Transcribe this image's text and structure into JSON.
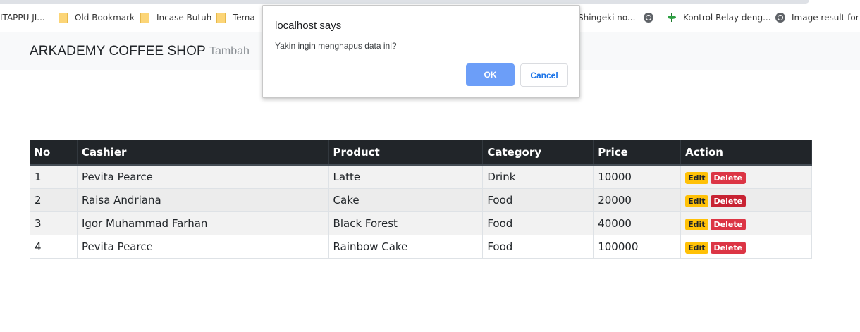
{
  "bookmarks": [
    {
      "icon": "",
      "label": "ITAPPU JI..."
    },
    {
      "icon": "folder-icon",
      "label": "Old Bookmark"
    },
    {
      "icon": "folder-icon",
      "label": "Incase Butuh"
    },
    {
      "icon": "folder-icon",
      "label": "Tema"
    },
    {
      "icon": "",
      "label": "Shingeki no..."
    },
    {
      "icon": "globe-icon",
      "label": ""
    },
    {
      "icon": "plant-icon",
      "label": "Kontrol Relay deng..."
    },
    {
      "icon": "globe-icon",
      "label": "Image result for da"
    }
  ],
  "navbar": {
    "brand": "ARKADEMY COFFEE SHOP",
    "link": "Tambah"
  },
  "table": {
    "headers": [
      "No",
      "Cashier",
      "Product",
      "Category",
      "Price",
      "Action"
    ],
    "rows": [
      {
        "no": "1",
        "cashier": "Pevita Pearce",
        "product": "Latte",
        "category": "Drink",
        "price": "10000"
      },
      {
        "no": "2",
        "cashier": "Raisa Andriana",
        "product": "Cake",
        "category": "Food",
        "price": "20000"
      },
      {
        "no": "3",
        "cashier": "Igor Muhammad Farhan",
        "product": "Black Forest",
        "category": "Food",
        "price": "40000"
      },
      {
        "no": "4",
        "cashier": "Pevita Pearce",
        "product": "Rainbow Cake",
        "category": "Food",
        "price": "100000"
      }
    ],
    "edit_label": "Edit",
    "delete_label": "Delete"
  },
  "dialog": {
    "title": "localhost says",
    "message": "Yakin ingin menghapus data ini?",
    "ok_label": "OK",
    "cancel_label": "Cancel"
  },
  "colors": {
    "edit": "#ffc107",
    "delete": "#dc3545",
    "header": "#212529",
    "ok": "#6c9ef8"
  }
}
